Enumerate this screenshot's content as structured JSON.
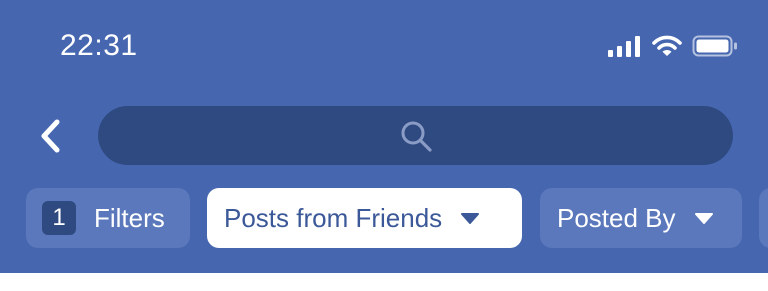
{
  "status_bar": {
    "time": "22:31",
    "icons": [
      "cellular-signal-icon",
      "wifi-icon",
      "battery-icon"
    ]
  },
  "nav": {
    "back_icon": "chevron-left-icon",
    "search": {
      "icon": "search-icon",
      "value": "",
      "placeholder": ""
    }
  },
  "filters": {
    "count": "1",
    "label": "Filters",
    "chips": [
      {
        "label": "Posts from Friends",
        "selected": true,
        "icon": "caret-down-icon"
      },
      {
        "label": "Posted By",
        "selected": false,
        "icon": "caret-down-icon"
      }
    ]
  },
  "colors": {
    "header_bg": "#4667b0",
    "search_bg": "#2f4a80",
    "chip_bg": "#5a78bb",
    "chip_selected_bg": "#ffffff",
    "chip_selected_text": "#3b5998",
    "badge_bg": "#2f4a80"
  }
}
